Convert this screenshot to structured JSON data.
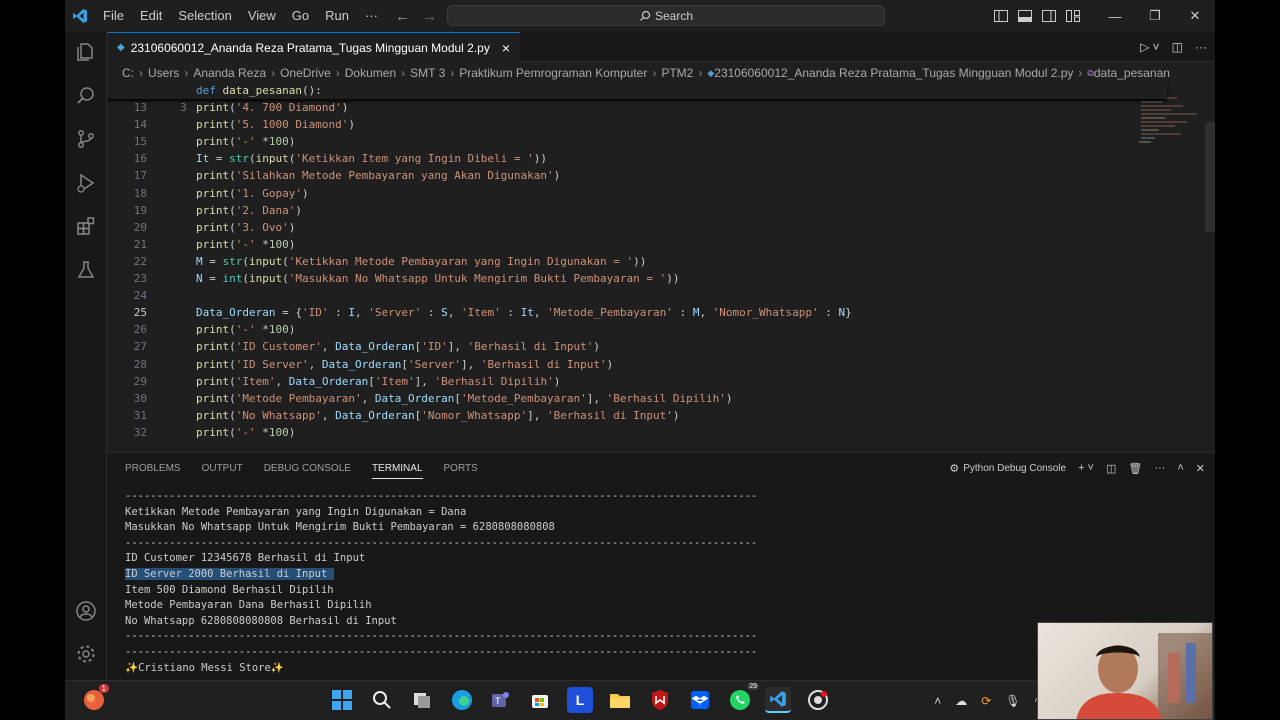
{
  "menu": [
    "File",
    "Edit",
    "Selection",
    "View",
    "Go",
    "Run",
    "···"
  ],
  "search_label": "Search",
  "tab": {
    "label": "23106060012_Ananda Reza Pratama_Tugas Mingguan Modul 2.py",
    "close": "×"
  },
  "breadcrumb": [
    "C:",
    "Users",
    "Ananda Reza",
    "OneDrive",
    "Dokumen",
    "SMT 3",
    "Praktikum Pemrograman Komputer",
    "PTM2",
    "23106060012_Ananda Reza Pratama_Tugas Mingguan Modul 2.py",
    "data_pesanan"
  ],
  "sticky": {
    "num": "3",
    "code_kw": "def",
    "code_fn": "data_pesanan",
    "code_rest": "():"
  },
  "code_lines": [
    {
      "num": "13",
      "parts": [
        [
          "f",
          "print"
        ],
        [
          "p",
          "("
        ],
        [
          "s",
          "'4. 700 Diamond'"
        ],
        [
          "p",
          ")"
        ]
      ]
    },
    {
      "num": "14",
      "parts": [
        [
          "f",
          "print"
        ],
        [
          "p",
          "("
        ],
        [
          "s",
          "'5. 1000 Diamond'"
        ],
        [
          "p",
          ")"
        ]
      ]
    },
    {
      "num": "15",
      "parts": [
        [
          "f",
          "print"
        ],
        [
          "p",
          "("
        ],
        [
          "s",
          "'-'"
        ],
        [
          "p",
          " *"
        ],
        [
          "n",
          "100"
        ],
        [
          "p",
          ")"
        ]
      ]
    },
    {
      "num": "16",
      "parts": [
        [
          "v",
          "It"
        ],
        [
          "p",
          " = "
        ],
        [
          "c",
          "str"
        ],
        [
          "p",
          "("
        ],
        [
          "f",
          "input"
        ],
        [
          "p",
          "("
        ],
        [
          "s",
          "'Ketikkan Item yang Ingin Dibeli = '"
        ],
        [
          "p",
          "))"
        ]
      ]
    },
    {
      "num": "17",
      "parts": [
        [
          "f",
          "print"
        ],
        [
          "p",
          "("
        ],
        [
          "s",
          "'Silahkan Metode Pembayaran yang Akan Digunakan'"
        ],
        [
          "p",
          ")"
        ]
      ]
    },
    {
      "num": "18",
      "parts": [
        [
          "f",
          "print"
        ],
        [
          "p",
          "("
        ],
        [
          "s",
          "'1. Gopay'"
        ],
        [
          "p",
          ")"
        ]
      ]
    },
    {
      "num": "19",
      "parts": [
        [
          "f",
          "print"
        ],
        [
          "p",
          "("
        ],
        [
          "s",
          "'2. Dana'"
        ],
        [
          "p",
          ")"
        ]
      ]
    },
    {
      "num": "20",
      "parts": [
        [
          "f",
          "print"
        ],
        [
          "p",
          "("
        ],
        [
          "s",
          "'3. Ovo'"
        ],
        [
          "p",
          ")"
        ]
      ]
    },
    {
      "num": "21",
      "parts": [
        [
          "f",
          "print"
        ],
        [
          "p",
          "("
        ],
        [
          "s",
          "'-'"
        ],
        [
          "p",
          " *"
        ],
        [
          "n",
          "100"
        ],
        [
          "p",
          ")"
        ]
      ]
    },
    {
      "num": "22",
      "parts": [
        [
          "v",
          "M"
        ],
        [
          "p",
          " = "
        ],
        [
          "c",
          "str"
        ],
        [
          "p",
          "("
        ],
        [
          "f",
          "input"
        ],
        [
          "p",
          "("
        ],
        [
          "s",
          "'Ketikkan Metode Pembayaran yang Ingin Digunakan = '"
        ],
        [
          "p",
          "))"
        ]
      ]
    },
    {
      "num": "23",
      "parts": [
        [
          "v",
          "N"
        ],
        [
          "p",
          " = "
        ],
        [
          "c",
          "int"
        ],
        [
          "p",
          "("
        ],
        [
          "f",
          "input"
        ],
        [
          "p",
          "("
        ],
        [
          "s",
          "'Masukkan No Whatsapp Untuk Mengirim Bukti Pembayaran = '"
        ],
        [
          "p",
          "))"
        ]
      ]
    },
    {
      "num": "24",
      "parts": []
    },
    {
      "num": "25",
      "active": true,
      "parts": [
        [
          "v",
          "Data_Orderan"
        ],
        [
          "p",
          " = {"
        ],
        [
          "s",
          "'ID'"
        ],
        [
          "p",
          " : "
        ],
        [
          "v",
          "I"
        ],
        [
          "p",
          ", "
        ],
        [
          "s",
          "'Server'"
        ],
        [
          "p",
          " : "
        ],
        [
          "v",
          "S"
        ],
        [
          "p",
          ", "
        ],
        [
          "s",
          "'Item'"
        ],
        [
          "p",
          " : "
        ],
        [
          "v",
          "It"
        ],
        [
          "p",
          ", "
        ],
        [
          "s",
          "'Metode_Pembayaran'"
        ],
        [
          "p",
          " : "
        ],
        [
          "v",
          "M"
        ],
        [
          "p",
          ", "
        ],
        [
          "s",
          "'Nomor_Whatsapp'"
        ],
        [
          "p",
          " : "
        ],
        [
          "v",
          "N"
        ],
        [
          "p",
          "}"
        ]
      ]
    },
    {
      "num": "26",
      "parts": [
        [
          "f",
          "print"
        ],
        [
          "p",
          "("
        ],
        [
          "s",
          "'-'"
        ],
        [
          "p",
          " *"
        ],
        [
          "n",
          "100"
        ],
        [
          "p",
          ")"
        ]
      ]
    },
    {
      "num": "27",
      "parts": [
        [
          "f",
          "print"
        ],
        [
          "p",
          "("
        ],
        [
          "s",
          "'ID Customer'"
        ],
        [
          "p",
          ", "
        ],
        [
          "v",
          "Data_Orderan"
        ],
        [
          "p",
          "["
        ],
        [
          "s",
          "'ID'"
        ],
        [
          "p",
          "], "
        ],
        [
          "s",
          "'Berhasil di Input'"
        ],
        [
          "p",
          ")"
        ]
      ]
    },
    {
      "num": "28",
      "parts": [
        [
          "f",
          "print"
        ],
        [
          "p",
          "("
        ],
        [
          "s",
          "'ID Server'"
        ],
        [
          "p",
          ", "
        ],
        [
          "v",
          "Data_Orderan"
        ],
        [
          "p",
          "["
        ],
        [
          "s",
          "'Server'"
        ],
        [
          "p",
          "], "
        ],
        [
          "s",
          "'Berhasil di Input'"
        ],
        [
          "p",
          ")"
        ]
      ]
    },
    {
      "num": "29",
      "parts": [
        [
          "f",
          "print"
        ],
        [
          "p",
          "("
        ],
        [
          "s",
          "'Item'"
        ],
        [
          "p",
          ", "
        ],
        [
          "v",
          "Data_Orderan"
        ],
        [
          "p",
          "["
        ],
        [
          "s",
          "'Item'"
        ],
        [
          "p",
          "], "
        ],
        [
          "s",
          "'Berhasil Dipilih'"
        ],
        [
          "p",
          ")"
        ]
      ]
    },
    {
      "num": "30",
      "parts": [
        [
          "f",
          "print"
        ],
        [
          "p",
          "("
        ],
        [
          "s",
          "'Metode Pembayaran'"
        ],
        [
          "p",
          ", "
        ],
        [
          "v",
          "Data_Orderan"
        ],
        [
          "p",
          "["
        ],
        [
          "s",
          "'Metode_Pembayaran'"
        ],
        [
          "p",
          "], "
        ],
        [
          "s",
          "'Berhasil Dipilih'"
        ],
        [
          "p",
          ")"
        ]
      ]
    },
    {
      "num": "31",
      "parts": [
        [
          "f",
          "print"
        ],
        [
          "p",
          "("
        ],
        [
          "s",
          "'No Whatsapp'"
        ],
        [
          "p",
          ", "
        ],
        [
          "v",
          "Data_Orderan"
        ],
        [
          "p",
          "["
        ],
        [
          "s",
          "'Nomor_Whatsapp'"
        ],
        [
          "p",
          "], "
        ],
        [
          "s",
          "'Berhasil di Input'"
        ],
        [
          "p",
          ")"
        ]
      ]
    },
    {
      "num": "32",
      "parts": [
        [
          "f",
          "print"
        ],
        [
          "p",
          "("
        ],
        [
          "s",
          "'-'"
        ],
        [
          "p",
          " *"
        ],
        [
          "n",
          "100"
        ],
        [
          "p",
          ")"
        ]
      ]
    }
  ],
  "panel_tabs": [
    "PROBLEMS",
    "OUTPUT",
    "DEBUG CONSOLE",
    "TERMINAL",
    "PORTS"
  ],
  "panel_active": "TERMINAL",
  "debug_console_label": "Python Debug Console",
  "terminal_lines": [
    "----------------------------------------------------------------------------------------------------",
    "Ketikkan Metode Pembayaran yang Ingin Digunakan = Dana",
    "Masukkan No Whatsapp Untuk Mengirim Bukti Pembayaran = 6280808080808",
    "----------------------------------------------------------------------------------------------------",
    "ID Customer 12345678 Berhasil di Input",
    "ID Server 2000 Berhasil di Input ",
    "Item 500 Diamond Berhasil Dipilih",
    "Metode Pembayaran Dana Berhasil Dipilih",
    "No Whatsapp 6280808080808 Berhasil di Input",
    "----------------------------------------------------------------------------------------------------",
    "----------------------------------------------------------------------------------------------------",
    "✨Cristiano Messi Store✨"
  ],
  "selected_terminal_line": 5,
  "taskbar_badges": {
    "notification_count": "1",
    "whatsapp_count": "29"
  },
  "colors": {
    "accent": "#0078d4",
    "selection": "#264f78"
  }
}
